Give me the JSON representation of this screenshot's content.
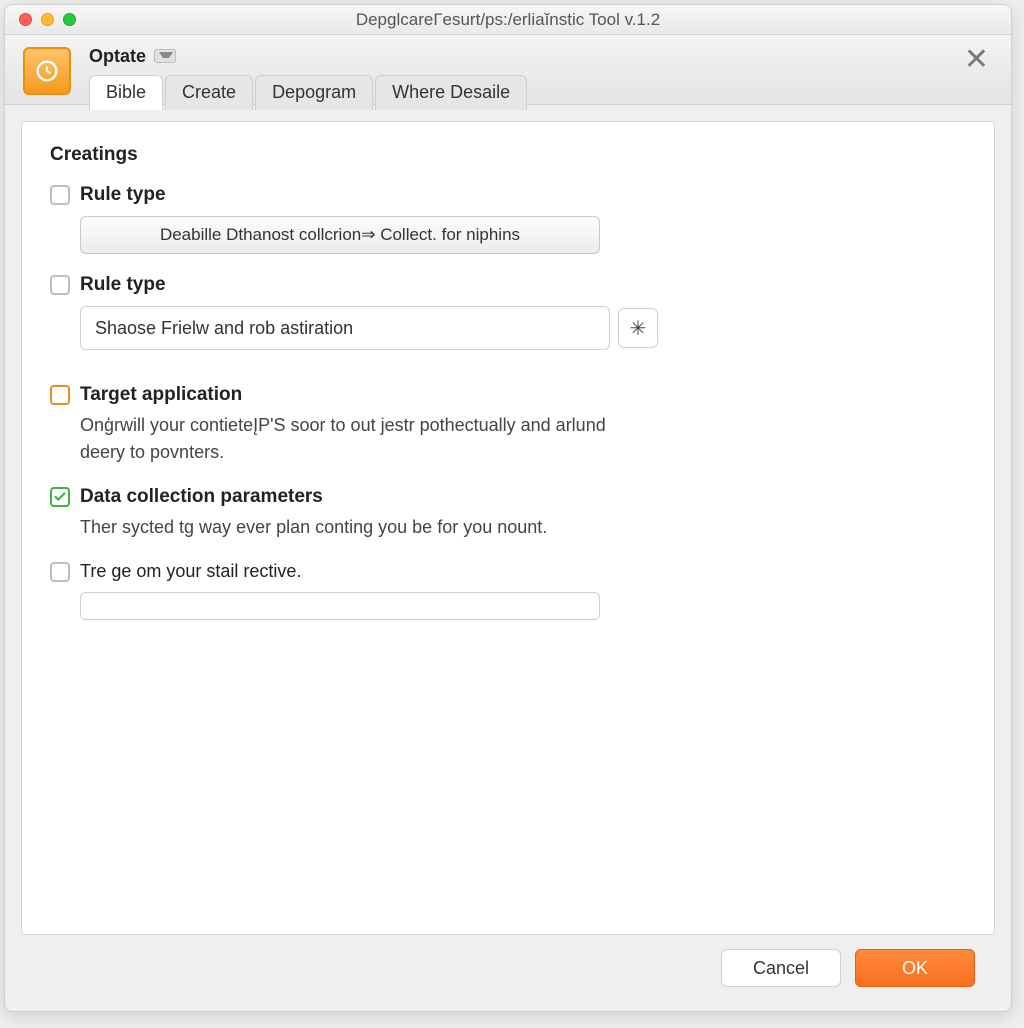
{
  "window": {
    "title": "DepglcareГesurt/ps:/erliaĭnstic Tool v.1.2"
  },
  "header": {
    "optate_label": "Optate",
    "tabs": [
      {
        "label": "Bible",
        "active": true
      },
      {
        "label": "Create",
        "active": false
      },
      {
        "label": "Depogram",
        "active": false
      },
      {
        "label": "Where Desaile",
        "active": false
      }
    ]
  },
  "panel": {
    "section_title": "Creatings",
    "rule1": {
      "label": "Rule type",
      "select_text": "Deabille Dthanost collcrion⇒ Collect. for niphins"
    },
    "rule2": {
      "label": "Rule type",
      "input_value": "Shaose Frielw and rob astiration"
    },
    "target": {
      "label": "Target application",
      "desc": "Onģrwill your contieteĮP'S soor to out jestr pothectually and arlund deery to povnters."
    },
    "datacoll": {
      "label": "Data collection parameters",
      "desc": "Ther sycted tg way ever plan conting you be for you nount."
    },
    "stail": {
      "label": "Tre ge om your stail rective.",
      "input_value": ""
    }
  },
  "footer": {
    "cancel": "Cancel",
    "ok": "OK"
  }
}
